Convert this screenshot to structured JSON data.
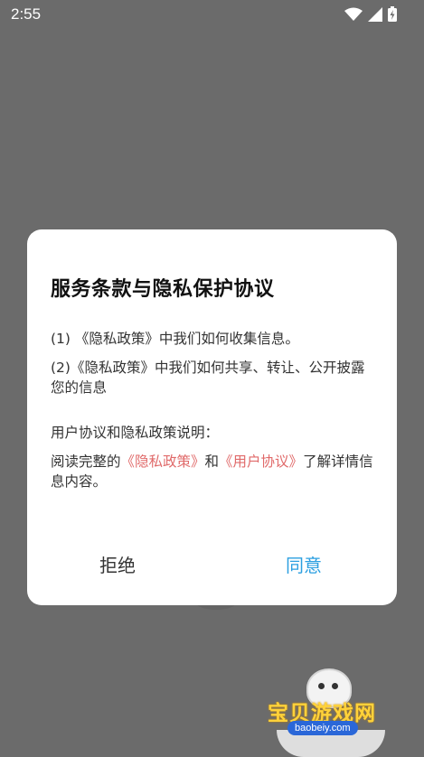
{
  "status_bar": {
    "time": "2:55"
  },
  "dialog": {
    "title": "服务条款与隐私保护协议",
    "paragraphs": {
      "p1": "(1) 《隐私政策》中我们如何收集信息。",
      "p2": "(2)《隐私政策》中我们如何共享、转让、公开披露您的信息",
      "p3": "用户协议和隐私政策说明：",
      "p4_prefix": "阅读完整的",
      "p4_link1": "《隐私政策》",
      "p4_mid": "和",
      "p4_link2": "《用户协议》",
      "p4_suffix": "了解详情信息内容。"
    },
    "buttons": {
      "reject": "拒绝",
      "agree": "同意"
    }
  },
  "colors": {
    "link": "#e06a6a",
    "agree": "#2b9fe0",
    "overlay": "#6b6b6b"
  },
  "watermark": {
    "text": "宝贝游戏网",
    "url": "baobeiy.com"
  }
}
